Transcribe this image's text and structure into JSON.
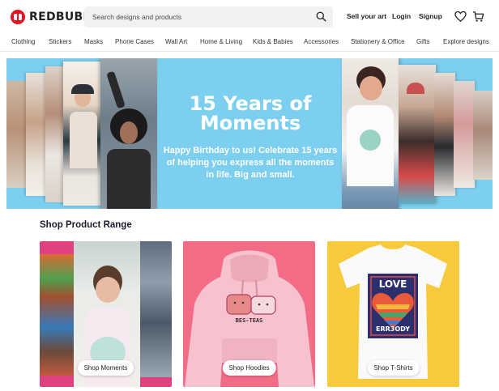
{
  "brand": {
    "name": "REDBUBBLE",
    "color": "#e41321"
  },
  "search": {
    "placeholder": "Search designs and products"
  },
  "header_links": {
    "sell": "Sell your art",
    "login": "Login",
    "signup": "Signup"
  },
  "nav": [
    "Clothing",
    "Stickers",
    "Masks",
    "Phone Cases",
    "Wall Art",
    "Home & Living",
    "Kids & Babies",
    "Accessories",
    "Stationery & Office",
    "Gifts",
    "Explore designs"
  ],
  "hero": {
    "title_line1": "15 Years of",
    "title_line2": "Moments",
    "subtitle_line1": "Happy Birthday to us! Celebrate 15 years",
    "subtitle_line2": "of helping you express all the moments",
    "subtitle_line3": "in life. Big and small.",
    "bg_color": "#7dcff0"
  },
  "product_range": {
    "title": "Shop Product Range",
    "cards": [
      {
        "button": "Shop Moments",
        "bg": "#e0417f"
      },
      {
        "button": "Shop Hoodies",
        "bg": "#f46b86",
        "print_text": "BES-TEAS"
      },
      {
        "button": "Shop T-Shirts",
        "bg": "#f7c93d",
        "print_line1": "LOVE",
        "print_line2": "ERR3ODY"
      }
    ]
  }
}
